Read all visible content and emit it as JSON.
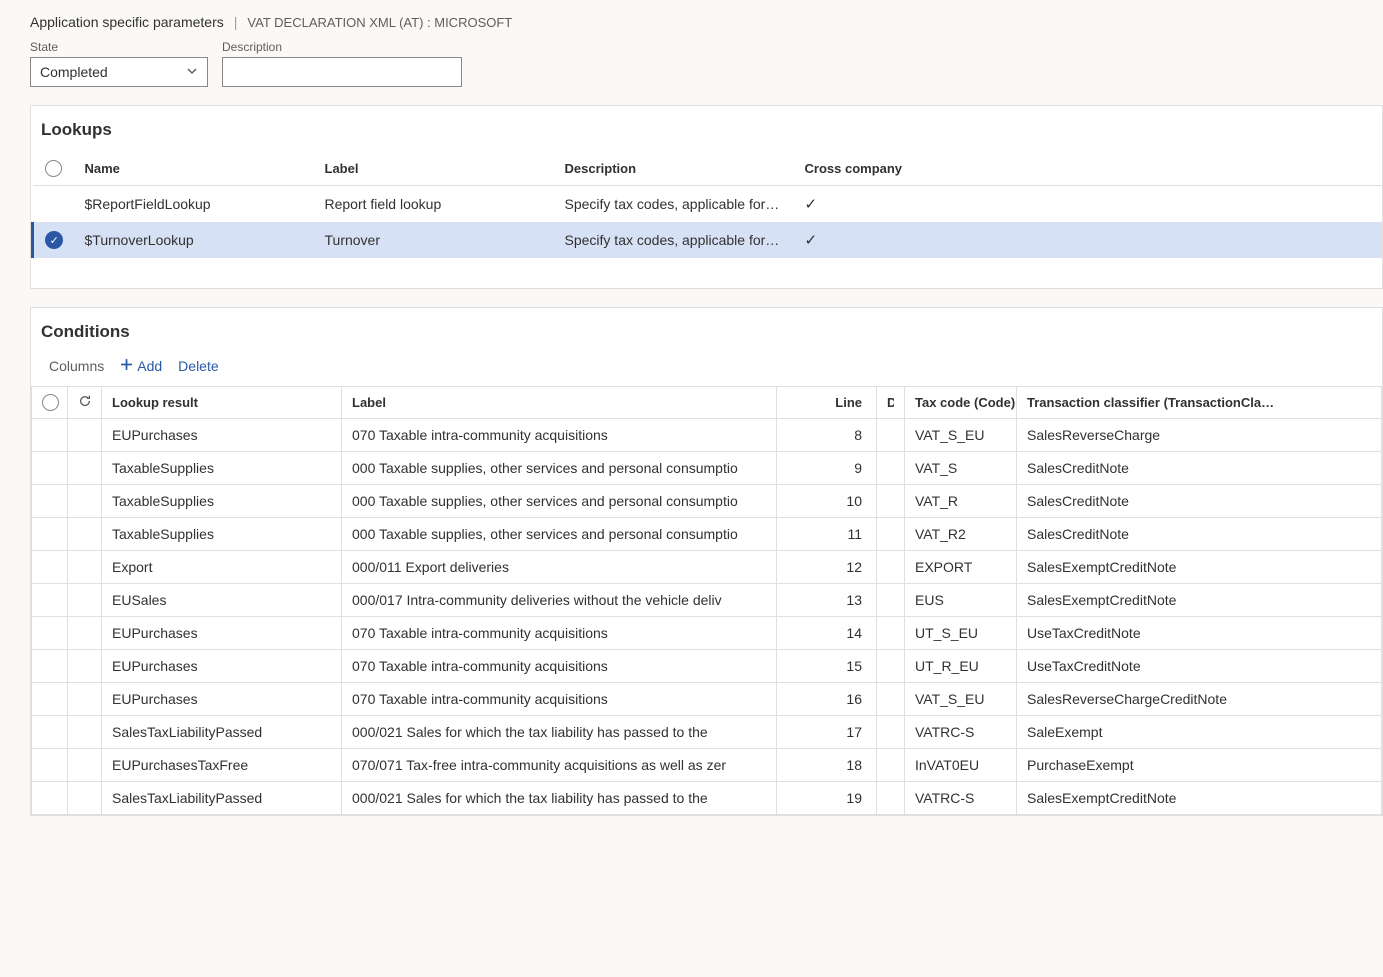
{
  "breadcrumb": {
    "title": "Application specific parameters",
    "separator": "|",
    "sub": "VAT DECLARATION XML (AT) : MICROSOFT"
  },
  "fields": {
    "state_label": "State",
    "state_value": "Completed",
    "description_label": "Description",
    "description_value": ""
  },
  "lookups": {
    "title": "Lookups",
    "headers": {
      "name": "Name",
      "label": "Label",
      "description": "Description",
      "cross": "Cross company"
    },
    "rows": [
      {
        "selected": false,
        "name": "$ReportFieldLookup",
        "label": "Report field lookup",
        "description": "Specify tax codes, applicable for…",
        "cross": true
      },
      {
        "selected": true,
        "name": "$TurnoverLookup",
        "label": "Turnover",
        "description": "Specify tax codes, applicable for…",
        "cross": true
      }
    ]
  },
  "conditions": {
    "title": "Conditions",
    "toolbar": {
      "columns": "Columns",
      "add": "Add",
      "delete": "Delete"
    },
    "headers": {
      "lookup_result": "Lookup result",
      "label": "Label",
      "line": "Line",
      "d": "D…",
      "tax_code": "Tax code (Code)",
      "transaction_classifier": "Transaction classifier (TransactionCla…"
    },
    "rows": [
      {
        "lookup_result": "EUPurchases",
        "label": "070 Taxable intra-community acquisitions",
        "line": "8",
        "tax_code": "VAT_S_EU",
        "tc": "SalesReverseCharge"
      },
      {
        "lookup_result": "TaxableSupplies",
        "label": "000 Taxable supplies, other services and personal consumptio",
        "line": "9",
        "tax_code": "VAT_S",
        "tc": "SalesCreditNote"
      },
      {
        "lookup_result": "TaxableSupplies",
        "label": "000 Taxable supplies, other services and personal consumptio",
        "line": "10",
        "tax_code": "VAT_R",
        "tc": "SalesCreditNote"
      },
      {
        "lookup_result": "TaxableSupplies",
        "label": "000 Taxable supplies, other services and personal consumptio",
        "line": "11",
        "tax_code": "VAT_R2",
        "tc": "SalesCreditNote"
      },
      {
        "lookup_result": "Export",
        "label": "000/011 Export deliveries",
        "line": "12",
        "tax_code": "EXPORT",
        "tc": "SalesExemptCreditNote"
      },
      {
        "lookup_result": "EUSales",
        "label": "000/017 Intra-community deliveries without the vehicle deliv",
        "line": "13",
        "tax_code": "EUS",
        "tc": "SalesExemptCreditNote"
      },
      {
        "lookup_result": "EUPurchases",
        "label": "070 Taxable intra-community acquisitions",
        "line": "14",
        "tax_code": "UT_S_EU",
        "tc": "UseTaxCreditNote"
      },
      {
        "lookup_result": "EUPurchases",
        "label": "070 Taxable intra-community acquisitions",
        "line": "15",
        "tax_code": "UT_R_EU",
        "tc": "UseTaxCreditNote"
      },
      {
        "lookup_result": "EUPurchases",
        "label": "070 Taxable intra-community acquisitions",
        "line": "16",
        "tax_code": "VAT_S_EU",
        "tc": "SalesReverseChargeCreditNote"
      },
      {
        "lookup_result": "SalesTaxLiabilityPassed",
        "label": "000/021 Sales for which the tax liability has passed to the",
        "line": "17",
        "tax_code": "VATRC-S",
        "tc": "SaleExempt"
      },
      {
        "lookup_result": "EUPurchasesTaxFree",
        "label": "070/071 Tax-free intra-community acquisitions as well as zer",
        "line": "18",
        "tax_code": "InVAT0EU",
        "tc": "PurchaseExempt"
      },
      {
        "lookup_result": "SalesTaxLiabilityPassed",
        "label": "000/021 Sales for which the tax liability has passed to the",
        "line": "19",
        "tax_code": "VATRC-S",
        "tc": "SalesExemptCreditNote"
      }
    ]
  }
}
